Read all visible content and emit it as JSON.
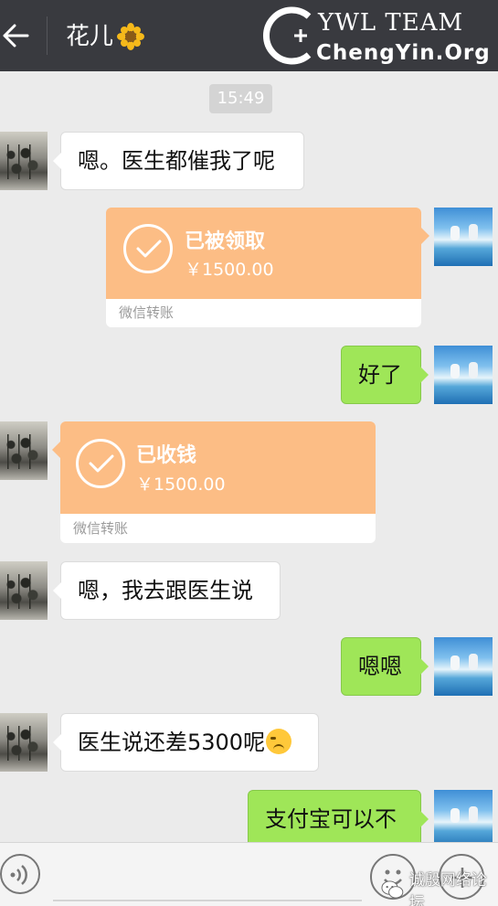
{
  "header": {
    "title": "花儿",
    "watermark_line1": "YWL TEAM",
    "watermark_line2": "ChengYin.Org"
  },
  "timestamp": "15:49",
  "messages": [
    {
      "side": "left",
      "type": "text",
      "text": "嗯。医生都催我了呢"
    },
    {
      "side": "right",
      "type": "transfer",
      "status": "已被领取",
      "amount": "￥1500.00",
      "footer": "微信转账"
    },
    {
      "side": "right",
      "type": "text",
      "text": "好了"
    },
    {
      "side": "left",
      "type": "transfer",
      "status": "已收钱",
      "amount": "￥1500.00",
      "footer": "微信转账"
    },
    {
      "side": "left",
      "type": "text",
      "text": "嗯，我去跟医生说"
    },
    {
      "side": "right",
      "type": "text",
      "text": "嗯嗯"
    },
    {
      "side": "left",
      "type": "text",
      "text": "医生说还差5300呢"
    },
    {
      "side": "right",
      "type": "text",
      "text": "支付宝可以不"
    }
  ],
  "footer_watermark": "诚殷网络论坛",
  "colors": {
    "header_bg": "#393a3f",
    "chat_bg": "#ebebeb",
    "green_bubble": "#9fe658",
    "transfer_orange": "#fcbd85"
  },
  "icons": [
    "back-arrow-icon",
    "flower-icon",
    "check-icon",
    "voice-icon",
    "emoji-icon",
    "plus-icon",
    "wechat-icon"
  ]
}
